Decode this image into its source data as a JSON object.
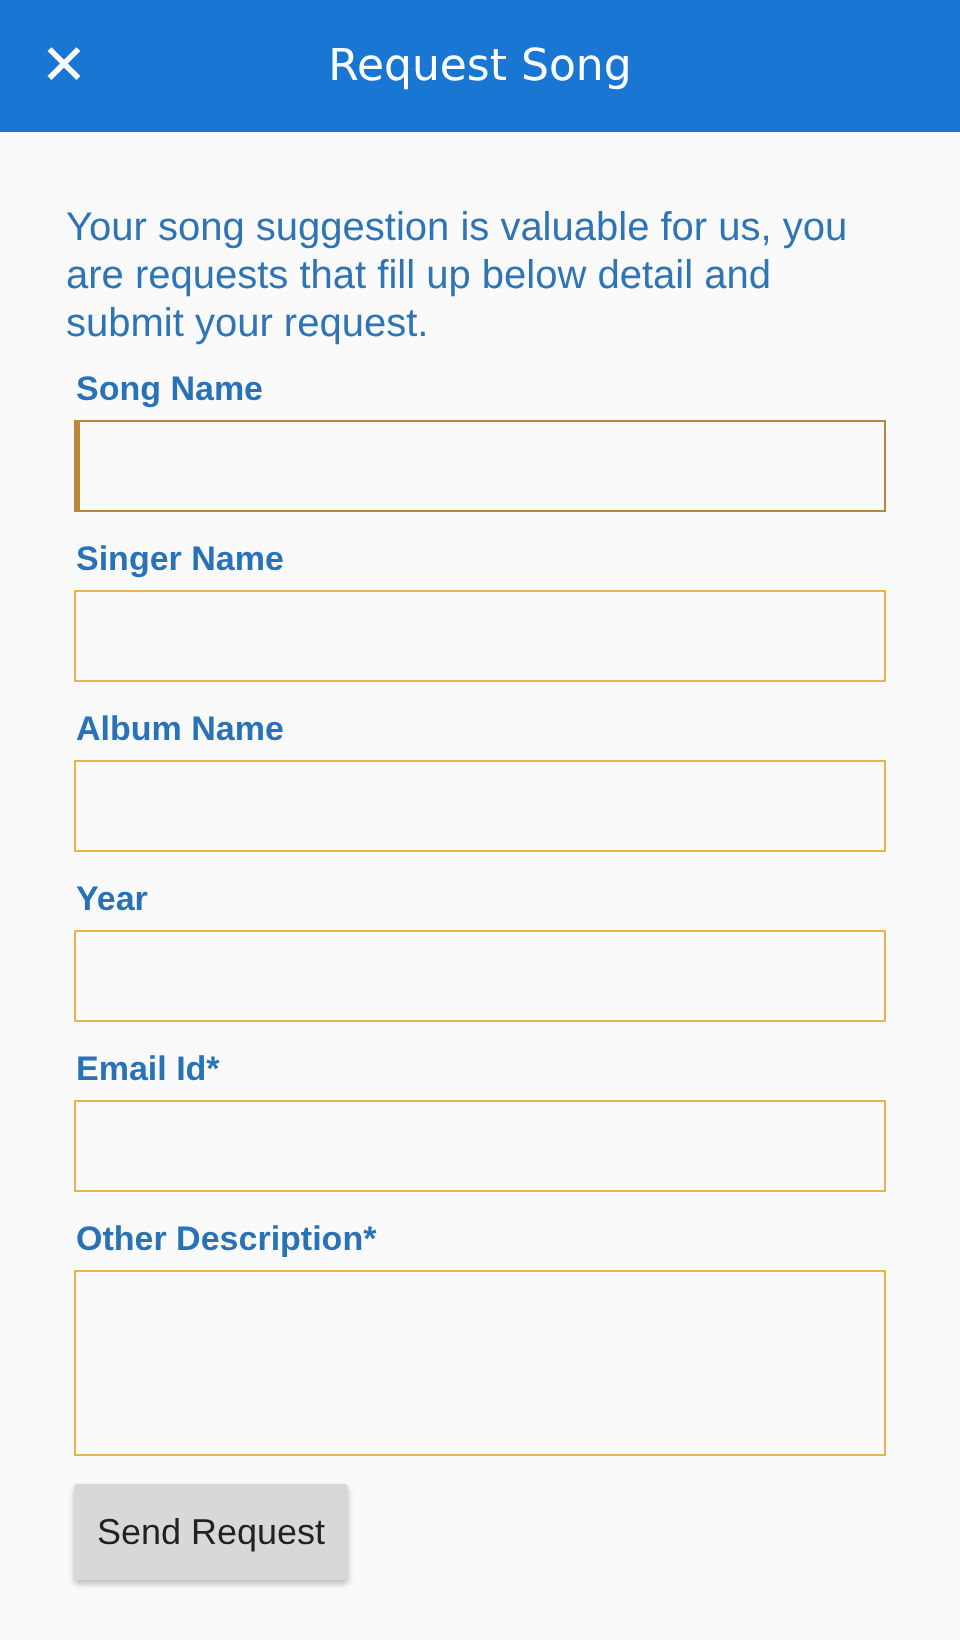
{
  "header": {
    "close_icon": "✕",
    "title": "Request Song"
  },
  "intro": "Your song suggestion is valuable for us, you are requests that fill up below detail and submit your request.",
  "fields": [
    {
      "label": "Song Name",
      "kind": "line",
      "focused": true
    },
    {
      "label": "Singer Name",
      "kind": "line",
      "focused": false
    },
    {
      "label": "Album Name",
      "kind": "line",
      "focused": false
    },
    {
      "label": "Year",
      "kind": "line",
      "focused": false
    },
    {
      "label": "Email Id*",
      "kind": "line",
      "focused": false
    },
    {
      "label": "Other Description*",
      "kind": "multiline",
      "focused": false
    }
  ],
  "submit_button": "Send Request"
}
